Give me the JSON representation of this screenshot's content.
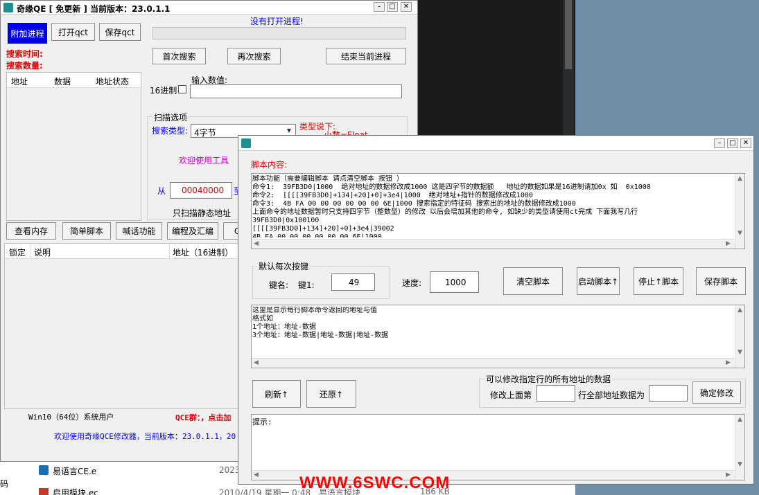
{
  "main_window": {
    "title": "奇缘QE [ 免更新 ] 当前版本：23.0.1.1",
    "attach_process": "附加进程",
    "open_qct": "打开qct",
    "save_qct": "保存qct",
    "no_process": "没有打开进程!",
    "first_search": "首次搜索",
    "next_search": "再次搜索",
    "end_process": "结束当前进程",
    "search_time": "搜索时间:",
    "search_count": "搜索数量:",
    "list_cols": [
      "地址",
      "数据",
      "地址状态"
    ],
    "hex_label": "16进制",
    "input_value_label": "输入数值:",
    "scan_options": "扫描选项",
    "search_type_label": "搜索类型:",
    "search_type_value": "4字节",
    "type_note_1": "类型说下:",
    "type_note_2": "小数=Float",
    "welcome_tool": "欢迎使用工具",
    "from_label": "从",
    "from_value": "00040000",
    "to_label": "至",
    "static_only": "只扫描静态地址",
    "tabs": [
      "查看内存",
      "简单脚本",
      "喊话功能",
      "编程及汇编",
      "Q"
    ],
    "table_cols": [
      "锁定",
      "说明",
      "地址（16进制）"
    ],
    "sys_user": "Win10（64位）系统用户",
    "qce_group": "QCE群：，点击加",
    "welcome_footer": "欢迎使用奇缘QCE修改器，当前版本：23.0.1.1，20"
  },
  "script_window": {
    "script_content_label": "脚本内容:",
    "script_text": "脚本功能（需要编辑脚本 请点清空脚本 按钮 ）\n命令1:  39FB3D0|1000  绝对地址的数据修改成1000 这是四字节的数据额   地址的数据如果是16进制请加0x 如  0x1000\n命令2:  [[[[39FB3D0]+134]+20]+0]+3e4|1000  绝对地址+指针的数据修改成1000\n命令3:  4B FA 00 00 00 00 00 00 6E|1000 搜索指定的特征码 搜索出的地址的数据修改成1000\n上面命令的地址数据暂时只支持四字节（整数型）的修改 以后会增加其他的命令, 如缺少的类型请使用ct完成 下面我写几行\n39FB3D0|0x100100\n[[[[39FB3D0]+134]+20]+0]+3e4|39002\n4B FA 00 00 00 00 00 00 6E|1000",
    "default_key_group": "默认每次按键",
    "key_name_label": "键名:",
    "key1_label": "键1:",
    "key1_value": "49",
    "speed_label": "速度:",
    "speed_value": "1000",
    "clear_script": "清空脚本",
    "start_script": "启动脚本↑",
    "stop_script": "停止↑脚本",
    "save_script": "保存脚本",
    "output_text": "这里是显示每行脚本命令返回的地址与值\n格式如\n1个地址：地址-数据\n3个地址：地址-数据|地址-数据|地址-数据",
    "refresh": "刷新↑",
    "restore": "还原↑",
    "modify_group": "可以修改指定行的所有地址的数据",
    "modify_prefix": "修改上面第",
    "modify_middle": "行全部地址数据为",
    "confirm_modify": "确定修改",
    "tips_label": "提示:"
  },
  "explorer": {
    "file1": "易语言CE.e",
    "file1_date": "2023",
    "file2": "启用模块.ec",
    "file2_date": "2010/4/19 星期一 0:48",
    "file2_type": "易语言模块",
    "file2_size": "186 KB",
    "left_char": "码"
  },
  "watermark": "WWW.6SWC.COM",
  "colors": {
    "accent_blue": "#0000ff",
    "label_red": "#e00000",
    "watermark_red": "#ff0000",
    "magenta": "#cc00cc"
  }
}
